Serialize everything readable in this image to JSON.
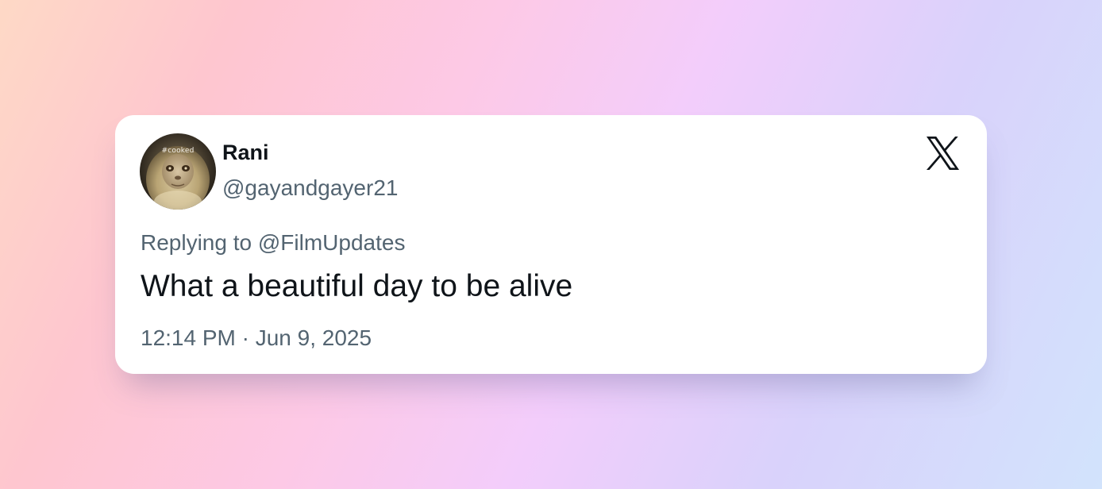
{
  "tweet": {
    "author": {
      "name": "Rani",
      "handle": "@gayandgayer21",
      "avatar_label": "#cooked"
    },
    "reply_to": "Replying to @FilmUpdates",
    "text": "What a beautiful day to be alive",
    "timestamp": "12:14 PM · Jun 9, 2025",
    "platform_icon": "x-logo-icon"
  },
  "colors": {
    "primary_text": "#0f1419",
    "secondary_text": "#536471",
    "card_background": "#ffffff"
  }
}
